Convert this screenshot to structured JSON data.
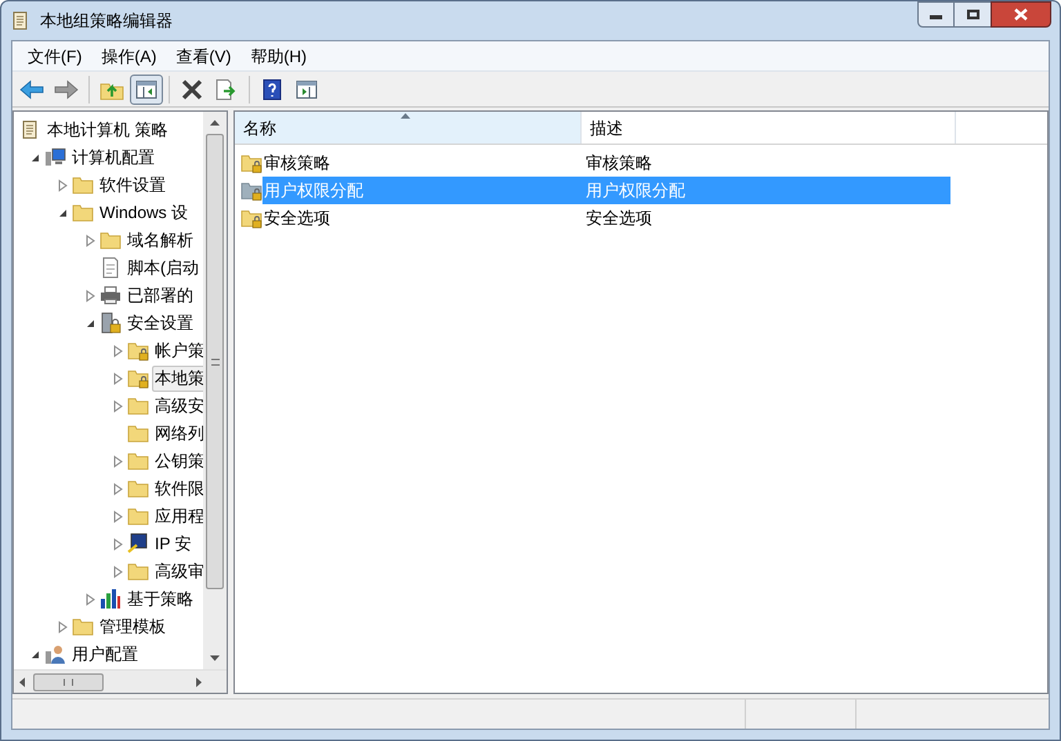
{
  "window": {
    "title": "本地组策略编辑器"
  },
  "menu": [
    "文件(F)",
    "操作(A)",
    "查看(V)",
    "帮助(H)"
  ],
  "toolbar": [
    {
      "kind": "back"
    },
    {
      "kind": "forward"
    },
    {
      "kind": "sep"
    },
    {
      "kind": "up"
    },
    {
      "kind": "pane",
      "selected": true
    },
    {
      "kind": "sep"
    },
    {
      "kind": "delete"
    },
    {
      "kind": "export"
    },
    {
      "kind": "sep"
    },
    {
      "kind": "help"
    },
    {
      "kind": "view"
    }
  ],
  "tree": [
    {
      "label": "本地计算机 策略",
      "kind": "policy",
      "selected": false,
      "children": [
        {
          "label": "计算机配置",
          "kind": "computer",
          "expanded": true,
          "selected": false,
          "children": [
            {
              "label": "软件设置",
              "kind": "folder",
              "expanded": false,
              "selected": false
            },
            {
              "label": "Windows 设",
              "kind": "folder",
              "expanded": true,
              "selected": false,
              "children": [
                {
                  "label": "域名解析",
                  "kind": "folder",
                  "expanded": false,
                  "selected": false
                },
                {
                  "label": "脚本(启动",
                  "kind": "script",
                  "selected": false
                },
                {
                  "label": "已部署的",
                  "kind": "printer",
                  "expanded": false,
                  "selected": false
                },
                {
                  "label": "安全设置",
                  "kind": "security",
                  "expanded": true,
                  "selected": false,
                  "children": [
                    {
                      "label": "帐户策",
                      "kind": "folder-lock",
                      "expanded": false,
                      "selected": false
                    },
                    {
                      "label": "本地策",
                      "kind": "folder-lock",
                      "expanded": false,
                      "selected": true
                    },
                    {
                      "label": "高级安",
                      "kind": "folder",
                      "expanded": false,
                      "selected": false
                    },
                    {
                      "label": "网络列",
                      "kind": "folder",
                      "selected": false
                    },
                    {
                      "label": "公钥策",
                      "kind": "folder",
                      "expanded": false,
                      "selected": false
                    },
                    {
                      "label": "软件限",
                      "kind": "folder",
                      "expanded": false,
                      "selected": false
                    },
                    {
                      "label": "应用程",
                      "kind": "folder",
                      "expanded": false,
                      "selected": false
                    },
                    {
                      "label": "IP 安",
                      "kind": "ip",
                      "expanded": false,
                      "selected": false
                    },
                    {
                      "label": "高级审",
                      "kind": "folder",
                      "expanded": false,
                      "selected": false
                    }
                  ]
                },
                {
                  "label": "基于策略",
                  "kind": "chart",
                  "expanded": false,
                  "selected": false
                }
              ]
            },
            {
              "label": "管理模板",
              "kind": "folder",
              "expanded": false,
              "selected": false
            }
          ]
        },
        {
          "label": "用户配置",
          "kind": "user",
          "expanded": true,
          "selected": false
        }
      ]
    }
  ],
  "list": {
    "columns": [
      "名称",
      "描述"
    ],
    "rows": [
      {
        "name": "审核策略",
        "description": "审核策略",
        "selected": false
      },
      {
        "name": "用户权限分配",
        "description": "用户权限分配",
        "selected": true
      },
      {
        "name": "安全选项",
        "description": "安全选项",
        "selected": false
      }
    ]
  }
}
